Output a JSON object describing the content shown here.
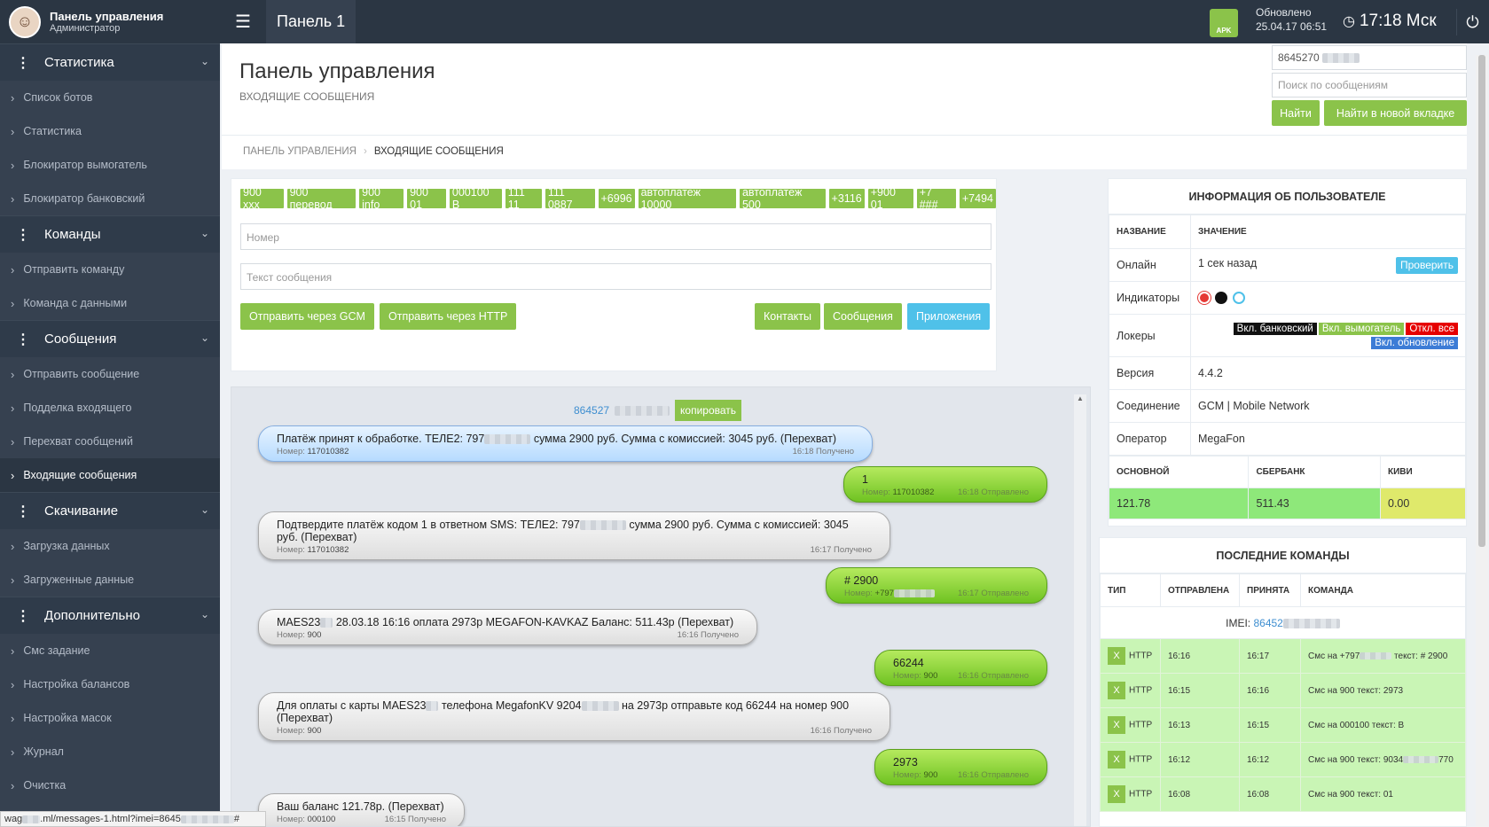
{
  "sidebar": {
    "user_name": "Панель управления",
    "user_role": "Администратор",
    "sections": [
      {
        "title": "Статистика",
        "items": [
          "Список ботов",
          "Статистика",
          "Блокиратор вымогатель",
          "Блокиратор банковский"
        ]
      },
      {
        "title": "Команды",
        "items": [
          "Отправить команду",
          "Команда с данными"
        ]
      },
      {
        "title": "Сообщения",
        "items": [
          "Отправить сообщение",
          "Подделка входящего",
          "Перехват сообщений",
          "Входящие сообщения"
        ]
      },
      {
        "title": "Скачивание",
        "items": [
          "Загрузка данных",
          "Загруженные данные"
        ]
      },
      {
        "title": "Дополнительно",
        "items": [
          "Смс задание",
          "Настройка балансов",
          "Настройка масок",
          "Журнал",
          "Очистка"
        ]
      }
    ]
  },
  "topbar": {
    "title": "Панель 1",
    "apk_label": "APK",
    "updated_label": "Обновлено",
    "updated_date": "25.04.17 06:51",
    "clock": "17:18 Мск"
  },
  "page": {
    "title": "Панель управления",
    "subtitle": "ВХОДЯЩИЕ СООБЩЕНИЯ",
    "search_value": "8645270",
    "search_placeholder": "Поиск по сообщениям",
    "find_btn": "Найти",
    "find_new_tab_btn": "Найти в новой вкладке"
  },
  "breadcrumb": {
    "root": "ПАНЕЛЬ УПРАВЛЕНИЯ",
    "current": "ВХОДЯЩИЕ СООБЩЕНИЯ"
  },
  "compose": {
    "templates": [
      "900 xxx",
      "900 перевод",
      "900 info",
      "900 01",
      "000100 B",
      "111 11",
      "111 0887",
      "+6996",
      "автоплатеж 10000",
      "автоплатеж 500",
      "+3116",
      "+900 01",
      "+7 ###",
      "+7494"
    ],
    "number_placeholder": "Номер",
    "text_placeholder": "Текст сообщения",
    "send_gcm": "Отправить через GCM",
    "send_http": "Отправить через HTTP",
    "contacts": "Контакты",
    "messages": "Сообщения",
    "apps": "Приложения"
  },
  "chat": {
    "imei": "864527",
    "copy_btn": "копировать",
    "messages": [
      {
        "dir": "in",
        "text": "Платёж принят к обработке. ТЕЛЕ2: 797",
        "text2": " сумма 2900 руб. Сумма с комиссией: 3045 руб. (Перехват)",
        "num_label": "Номер:",
        "num": "117010382",
        "time": "16:18 Получено"
      },
      {
        "dir": "out",
        "text": "1",
        "num_label": "Номер:",
        "num": "117010382",
        "time": "16:18 Отправлено"
      },
      {
        "dir": "in",
        "text": "Подтвердите платёж кодом 1 в ответном SMS: ТЕЛЕ2: 797",
        "text2": " сумма 2900 руб. Сумма с комиссией: 3045 руб. (Перехват)",
        "num_label": "Номер:",
        "num": "117010382",
        "time": "16:17 Получено"
      },
      {
        "dir": "out",
        "text": "# 2900",
        "num_label": "Номер:",
        "num": "+797",
        "time": "16:17 Отправлено"
      },
      {
        "dir": "in",
        "text": "MAES23",
        "text2": " 28.03.18 16:16 оплата 2973р MEGAFON-KAVKAZ Баланс: 511.43р (Перехват)",
        "num_label": "Номер:",
        "num": "900",
        "time": "16:16 Получено"
      },
      {
        "dir": "out",
        "text": "66244",
        "num_label": "Номер:",
        "num": "900",
        "time": "16:16 Отправлено"
      },
      {
        "dir": "in",
        "text": "Для оплаты с карты MAES23",
        "text2": " телефона MegafonKV 9204",
        "text3": " на 2973р отправьте код 66244 на номер 900 (Перехват)",
        "num_label": "Номер:",
        "num": "900",
        "time": "16:16 Получено"
      },
      {
        "dir": "out",
        "text": "2973",
        "num_label": "Номер:",
        "num": "900",
        "time": "16:16 Отправлено"
      },
      {
        "dir": "in",
        "text": "Ваш баланс 121.78р. (Перехват)",
        "num_label": "Номер:",
        "num": "000100",
        "time": "16:15 Получено"
      }
    ]
  },
  "userinfo": {
    "title": "ИНФОРМАЦИЯ ОБ ПОЛЬЗОВАТЕЛЕ",
    "col_name": "НАЗВАНИЕ",
    "col_value": "ЗНАЧЕНИЕ",
    "online_label": "Онлайн",
    "online_value": "1 сек назад",
    "check_btn": "Проверить",
    "indicators_label": "Индикаторы",
    "lockers_label": "Локеры",
    "lock_bank": "Вкл. банковский",
    "lock_ransom": "Вкл. вымогатель",
    "lock_off": "Откл. все",
    "lock_update": "Вкл. обновление",
    "version_label": "Версия",
    "version_value": "4.4.2",
    "conn_label": "Соединение",
    "conn_value": "GCM | Mobile Network",
    "operator_label": "Оператор",
    "operator_value": "MegaFon",
    "bal_main_label": "ОСНОВНОЙ",
    "bal_sber_label": "СБЕРБАНК",
    "bal_qiwi_label": "КИВИ",
    "bal_main": "121.78",
    "bal_sber": "511.43",
    "bal_qiwi": "0.00"
  },
  "commands": {
    "title": "ПОСЛЕДНИЕ КОМАНДЫ",
    "col_type": "ТИП",
    "col_sent": "ОТПРАВЛЕНА",
    "col_recv": "ПРИНЯТА",
    "col_cmd": "КОМАНДА",
    "imei_label": "IMEI:",
    "imei": "86452",
    "rows": [
      {
        "x": "X",
        "type": "HTTP",
        "sent": "16:16",
        "recv": "16:17",
        "cmd": "Смс на +797",
        "cmd2": " текст: # 2900"
      },
      {
        "x": "X",
        "type": "HTTP",
        "sent": "16:15",
        "recv": "16:16",
        "cmd": "Смс на 900 текст: 2973",
        "cmd2": ""
      },
      {
        "x": "X",
        "type": "HTTP",
        "sent": "16:13",
        "recv": "16:15",
        "cmd": "Смс на 000100 текст: B",
        "cmd2": ""
      },
      {
        "x": "X",
        "type": "HTTP",
        "sent": "16:12",
        "recv": "16:12",
        "cmd": "Смс на 900 текст: 9034",
        "cmd2": "770"
      },
      {
        "x": "X",
        "type": "HTTP",
        "sent": "16:08",
        "recv": "16:08",
        "cmd": "Смс на 900 текст: 01",
        "cmd2": ""
      }
    ]
  },
  "status_url": "wag",
  "status_url2": ".ml/messages-1.html?imei=8645",
  "status_url3": "#",
  "colors": {
    "sidebar": "#364150",
    "topbar": "#2b3643",
    "green": "#8bc34a",
    "blue": "#4fc1e9"
  }
}
